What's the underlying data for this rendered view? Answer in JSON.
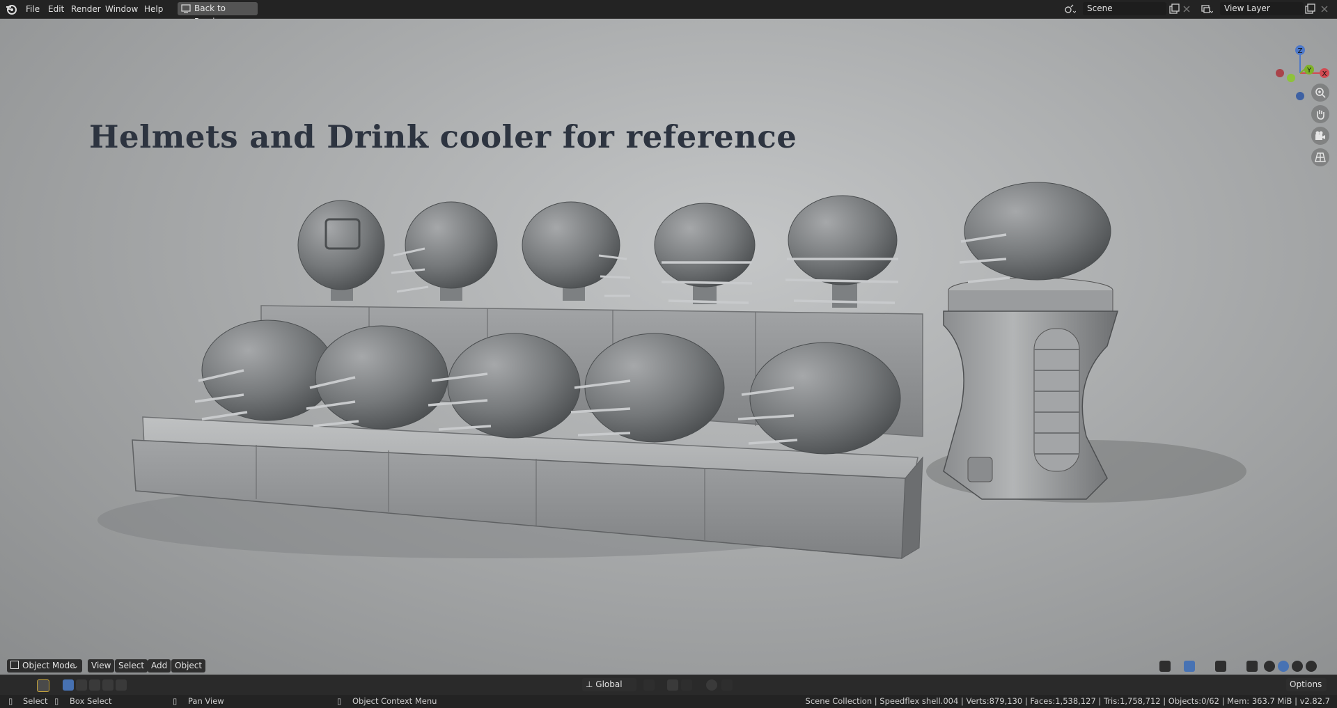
{
  "topbar": {
    "menus": [
      "File",
      "Edit",
      "Render",
      "Window",
      "Help"
    ],
    "back_button": "Back to Previous",
    "scene_field": "Scene",
    "view_layer_field": "View Layer"
  },
  "viewport": {
    "title_text": "Helmets and Drink cooler for reference",
    "gizmo": {
      "z": "Z",
      "y": "Y",
      "x": "X"
    }
  },
  "header": {
    "mode": "Object Mode",
    "menus": [
      "View",
      "Select",
      "Add",
      "Object"
    ],
    "orientation": "Global",
    "options": "Options"
  },
  "statusbar": {
    "select": "Select",
    "box_select": "Box Select",
    "pan_view": "Pan View",
    "context_menu": "Object Context Menu",
    "stats": "Scene Collection | Speedflex shell.004 | Verts:879,130 | Faces:1,538,127 | Tris:1,758,712 | Objects:0/62 | Mem: 363.7 MiB | v2.82.7"
  },
  "colors": {
    "accent": "#4772b3",
    "bg": "#232323",
    "title": "#2d3440"
  }
}
